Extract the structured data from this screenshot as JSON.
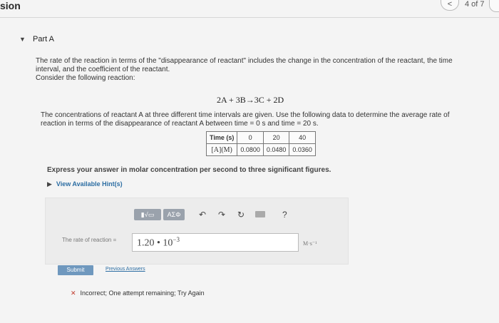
{
  "header": {
    "title": "sion",
    "prev_symbol": "<",
    "page_count": "4 of 7"
  },
  "part": {
    "toggle_symbol": "▼",
    "label": "Part A"
  },
  "question": {
    "intro_lines": [
      "The rate of the reaction in terms of the \"disappearance of reactant\" includes the change in the concentration of the reactant, the time",
      "interval, and the coefficient of the reactant.",
      "Consider the following reaction:"
    ],
    "equation": "2A + 3B→3C + 2D",
    "data_lines": [
      "The concentrations of reactant A at three different time intervals are given. Use the following data to determine the average rate of",
      "reaction in terms of the disappearance of reactant A between time = 0 s and time = 20 s."
    ],
    "table": {
      "row1_label": "Time (s)",
      "row1_values": [
        "0",
        "20",
        "40"
      ],
      "row2_label": "[A](M)",
      "row2_values": [
        "0.0800",
        "0.0480",
        "0.0360"
      ]
    },
    "instruction": "Express your answer in molar concentration per second to three significant figures.",
    "hints_label": "View Available Hint(s)",
    "hints_arrow": "▶"
  },
  "toolbar": {
    "template_label": "▮√▭",
    "symbols_label": "ΑΣΦ",
    "undo_symbol": "↶",
    "redo_symbol": "↷",
    "reset_symbol": "↻",
    "help_symbol": "?"
  },
  "answer": {
    "rate_label": "The rate of reaction =",
    "value_mantissa": "1.20 • 10",
    "value_exponent": "−3",
    "units": "M·s⁻¹"
  },
  "actions": {
    "submit_label": "Submit",
    "previous_answers_label": "Previous Answers"
  },
  "feedback": {
    "icon": "✕",
    "text": "Incorrect; One attempt remaining; Try Again"
  }
}
